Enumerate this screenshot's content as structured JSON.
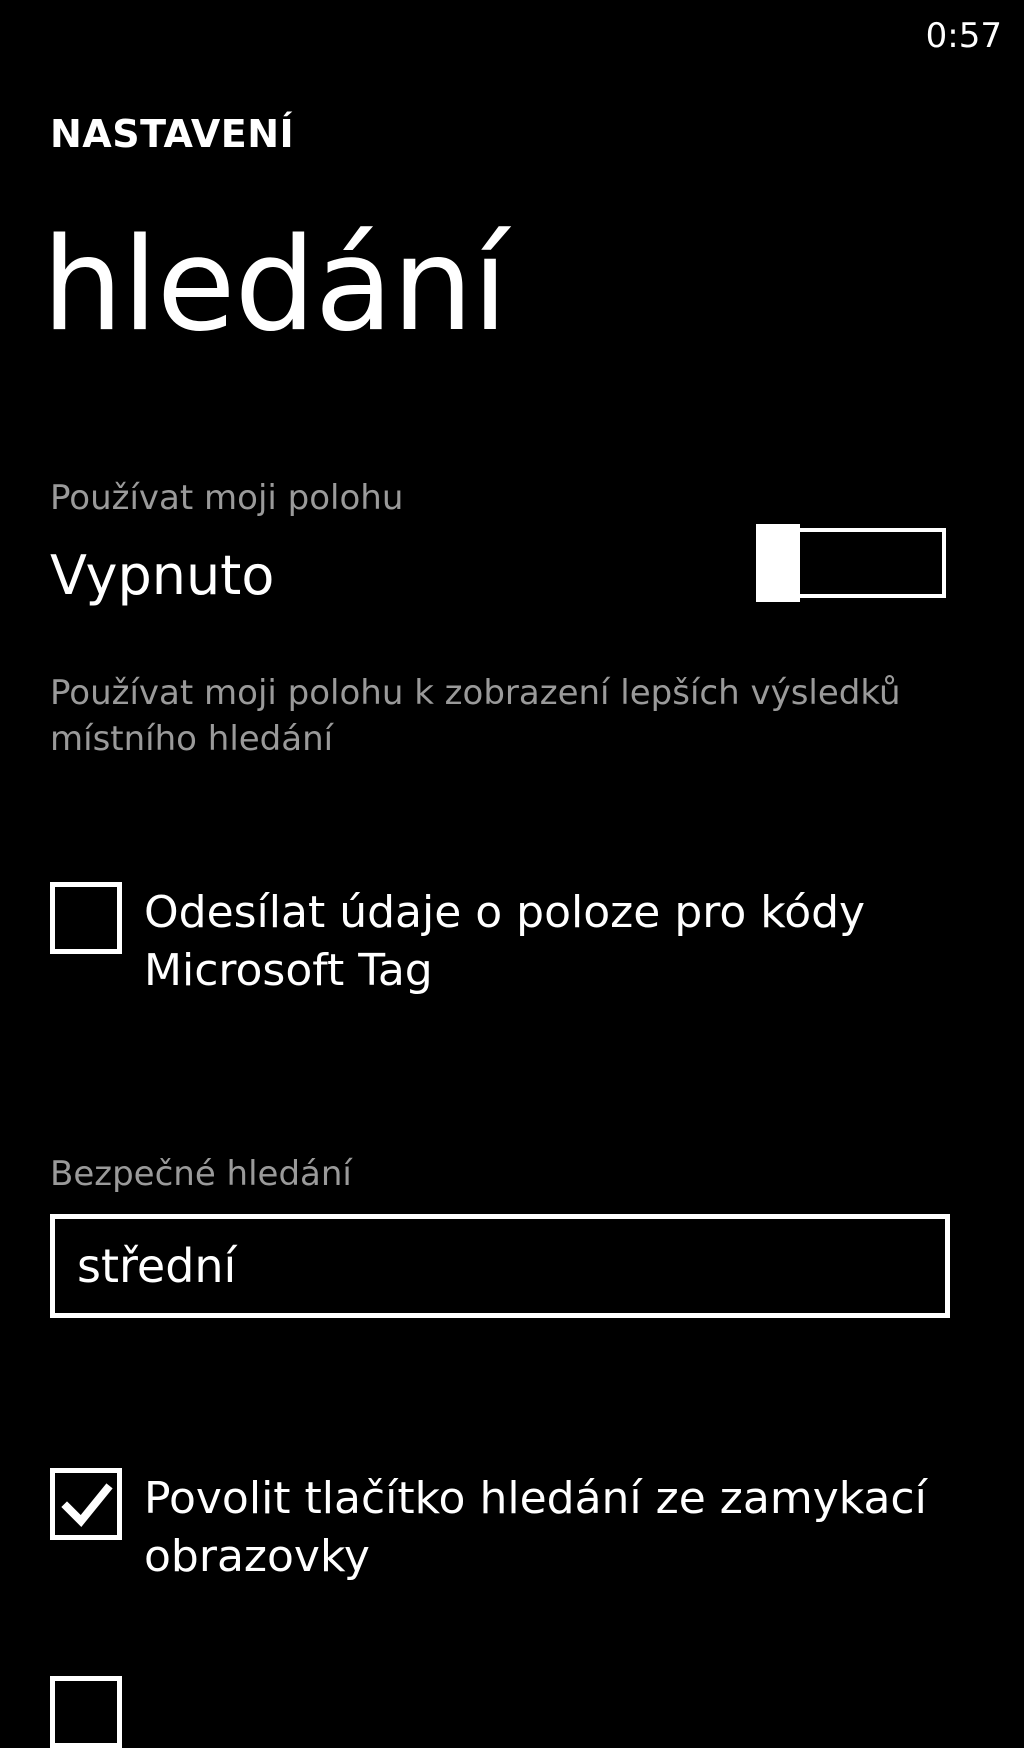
{
  "status_bar": {
    "time": "0:57"
  },
  "header": {
    "app_title": "NASTAVENÍ",
    "page_title": "hledání"
  },
  "location": {
    "label": "Používat moji polohu",
    "value": "Vypnuto",
    "enabled": false,
    "description": "Používat moji polohu k zobrazení lepších výsledků místního hledání"
  },
  "microsoft_tag": {
    "label": "Odesílat údaje o poloze pro kódy Microsoft Tag",
    "checked": false
  },
  "safe_search": {
    "label": "Bezpečné hledání",
    "selected": "střední"
  },
  "lock_screen_search": {
    "label": "Povolit tlačítko hledání ze zamykací obrazovky",
    "checked": true
  },
  "colors": {
    "background": "#000000",
    "foreground": "#ffffff",
    "secondary_text": "#9a9a9a"
  }
}
